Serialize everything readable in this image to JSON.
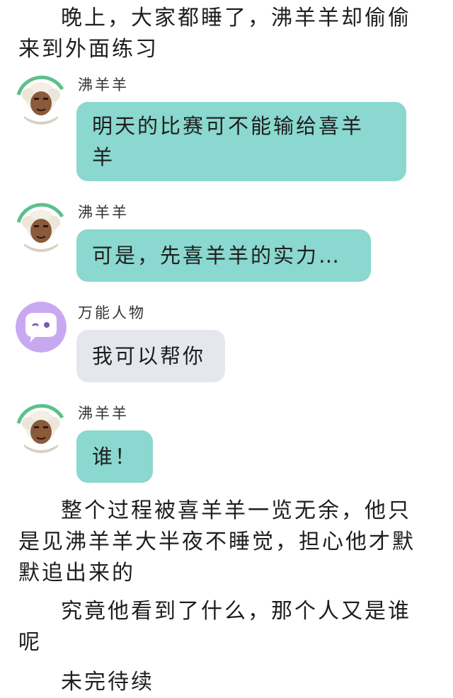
{
  "story": {
    "intro": "晚上，大家都睡了，沸羊羊却偷偷来到外面练习",
    "intro_line1": "晚上，大家都睡了，沸羊羊却偷偷",
    "intro_line2": "来到外面练习",
    "para2_line1": "整个过程被喜羊羊一览无余，他只",
    "para2_line2": "是见沸羊羊大半夜不睡觉，担心他才默",
    "para2_line3": "默追出来的",
    "para3_line1": "究竟他看到了什么，那个人又是谁",
    "para3_line2": "呢",
    "ending": "未完待续"
  },
  "chat": [
    {
      "speaker": "沸羊羊",
      "text_line1": "明天的比赛可不能输给喜羊",
      "text_line2": "羊",
      "avatar_icon": "fei-yang-yang-avatar",
      "bubble_color": "#8ad8cf"
    },
    {
      "speaker": "沸羊羊",
      "text": "可是，先喜羊羊的实力…",
      "avatar_icon": "fei-yang-yang-avatar",
      "bubble_color": "#8ad8cf"
    },
    {
      "speaker": "万能人物",
      "text": "我可以帮你",
      "avatar_icon": "chat-bubble-avatar",
      "bubble_color": "#e4e7ee"
    },
    {
      "speaker": "沸羊羊",
      "text": "谁！",
      "avatar_icon": "fei-yang-yang-avatar",
      "bubble_color": "#8ad8cf"
    }
  ],
  "colors": {
    "accent_teal": "#8ad8cf",
    "grey_bubble": "#e4e7ee",
    "avatar_purple": "#c9a8f2"
  }
}
